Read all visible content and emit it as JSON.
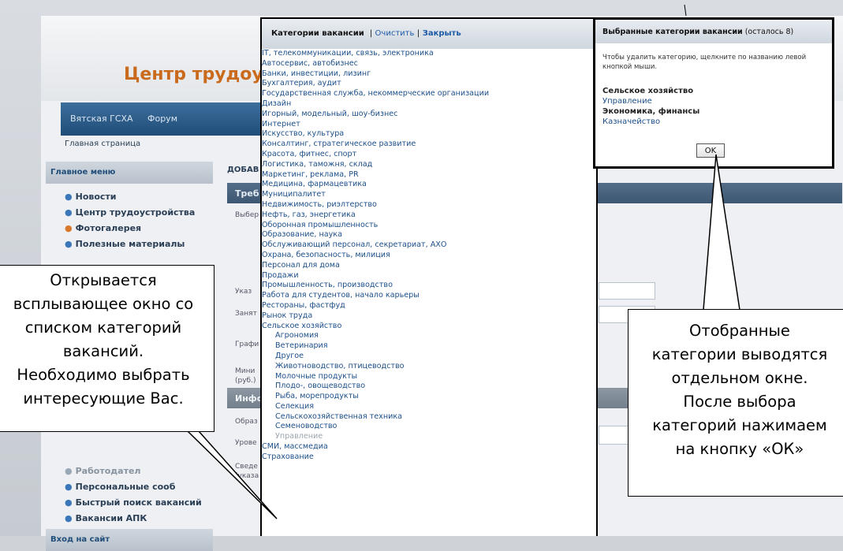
{
  "site": {
    "title": "Центр трудоус",
    "nav": [
      "Вятская ГСХА",
      "Форум"
    ],
    "breadcrumb": "Главная страница",
    "menu_header": "Главное меню",
    "menu": [
      "Новости",
      "Центр трудоустройства",
      "Фотогалерея",
      "Полезные материалы"
    ],
    "menu_lower": [
      "Работодател",
      "Персональные сооб",
      "Быстрый поиск вакансий",
      "Вакансии АПК"
    ],
    "login_header": "Вход на сайт",
    "form_title": "ДОБАВ",
    "form_section": "Треб",
    "form_labels": [
      "Выбер",
      "Указ",
      "Занят",
      "Графи",
      "Мини",
      "(руб.)",
      "Инфо",
      "Образ",
      "Урове",
      "Сведе",
      "(указа"
    ]
  },
  "popup": {
    "title": "Категории вакансии",
    "separator": "|",
    "clear": "Очистить",
    "close": "Закрыть",
    "categories": [
      {
        "label": "IT, телекоммуникации, связь, электроника",
        "level": 0
      },
      {
        "label": "Автосервис, автобизнес",
        "level": 0
      },
      {
        "label": "Банки, инвестиции, лизинг",
        "level": 0
      },
      {
        "label": "Бухгалтерия, аудит",
        "level": 0
      },
      {
        "label": "Государственная служба, некоммерческие организации",
        "level": 0
      },
      {
        "label": "Дизайн",
        "level": 0
      },
      {
        "label": "Игорный, модельный, шоу-бизнес",
        "level": 0
      },
      {
        "label": "Интернет",
        "level": 0
      },
      {
        "label": "Искусство, культура",
        "level": 0
      },
      {
        "label": "Консалтинг, стратегическое развитие",
        "level": 0
      },
      {
        "label": "Красота, фитнес, спорт",
        "level": 0
      },
      {
        "label": "Логистика, таможня, склад",
        "level": 0
      },
      {
        "label": "Маркетинг, реклама, PR",
        "level": 0
      },
      {
        "label": "Медицина, фармацевтика",
        "level": 0
      },
      {
        "label": "Муниципалитет",
        "level": 0
      },
      {
        "label": "Недвижимость, риэлтерство",
        "level": 0
      },
      {
        "label": "Нефть, газ, энергетика",
        "level": 0
      },
      {
        "label": "Оборонная промышленность",
        "level": 0
      },
      {
        "label": "Образование, наука",
        "level": 0
      },
      {
        "label": "Обслуживающий персонал, секретариат, АХО",
        "level": 0
      },
      {
        "label": "Охрана, безопасность, милиция",
        "level": 0
      },
      {
        "label": "Персонал для дома",
        "level": 0
      },
      {
        "label": "Продажи",
        "level": 0
      },
      {
        "label": "Промышленность, производство",
        "level": 0
      },
      {
        "label": "Работа для студентов, начало карьеры",
        "level": 0
      },
      {
        "label": "Рестораны, фастфуд",
        "level": 0
      },
      {
        "label": "Рынок труда",
        "level": 0
      },
      {
        "label": "Сельское хозяйство",
        "level": 0
      },
      {
        "label": "Агрономия",
        "level": 1
      },
      {
        "label": "Ветеринария",
        "level": 1
      },
      {
        "label": "Другое",
        "level": 1
      },
      {
        "label": "Животноводство, птицеводство",
        "level": 1
      },
      {
        "label": "Молочные продукты",
        "level": 1
      },
      {
        "label": "Плодо-, овощеводство",
        "level": 1
      },
      {
        "label": "Рыба, морепродукты",
        "level": 1
      },
      {
        "label": "Селекция",
        "level": 1
      },
      {
        "label": "Сельскохозяйственная техника",
        "level": 1
      },
      {
        "label": "Семеноводство",
        "level": 1
      },
      {
        "label": "Управление",
        "level": 1,
        "greyed": true
      },
      {
        "label": "СМИ, массмедиа",
        "level": 0
      },
      {
        "label": "Страхование",
        "level": 0
      }
    ]
  },
  "selected": {
    "title": "Выбранные категории вакансии",
    "remaining": "(осталось 8)",
    "hint": "Чтобы удалить категорию, щелкните по названию левой кнопкой мыши.",
    "items": [
      {
        "label": "Сельское хозяйство",
        "type": "group"
      },
      {
        "label": "Управление",
        "type": "item"
      },
      {
        "label": "Экономика, финансы",
        "type": "group"
      },
      {
        "label": "Казначейство",
        "type": "item"
      }
    ],
    "ok_label": "OK"
  },
  "callouts": {
    "left": [
      "Открывается",
      "всплывающее окно со",
      "списком категорий",
      "вакансий.",
      "Необходимо выбрать",
      "интересующие Вас."
    ],
    "right": [
      "Отобранные",
      "категории выводятся",
      "отдельном окне.",
      "После выбора",
      "категорий нажимаем",
      "на кнопку «ОК»"
    ]
  }
}
